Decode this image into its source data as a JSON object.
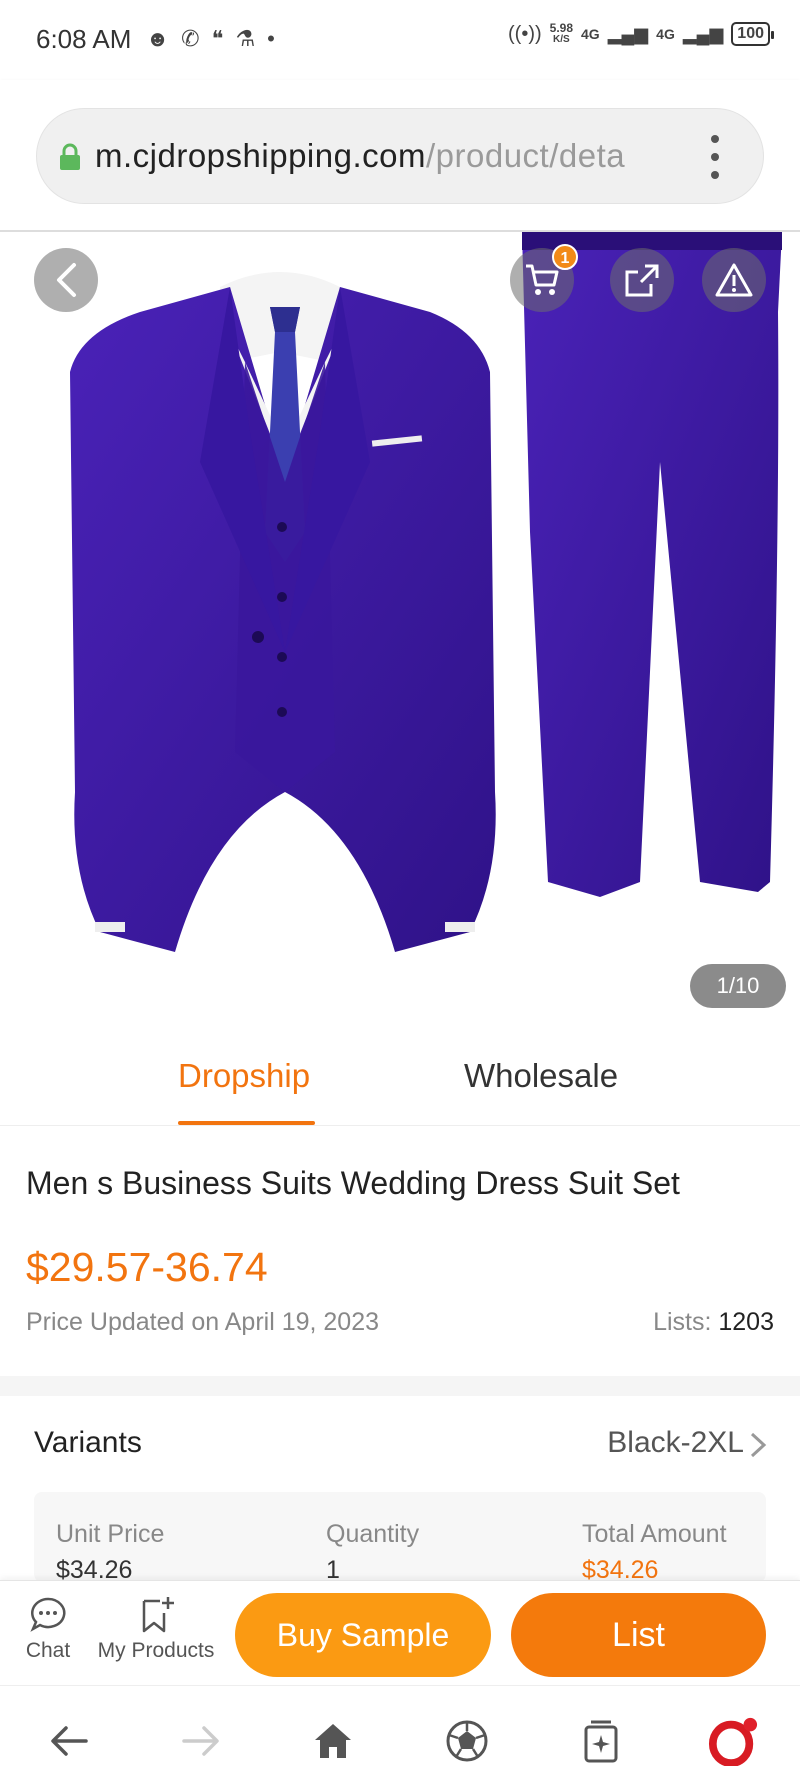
{
  "status_bar": {
    "time": "6:08 AM",
    "net_speed_value": "5.98",
    "net_speed_unit": "K/S",
    "signal1": "4G",
    "signal2": "4G",
    "battery": "100"
  },
  "browser": {
    "url_domain": "m.cjdropshipping.com",
    "url_path": "/product/deta"
  },
  "hero": {
    "cart_count": "1",
    "image_counter": "1/10"
  },
  "tabs": [
    {
      "label": "Dropship",
      "active": true
    },
    {
      "label": "Wholesale",
      "active": false
    }
  ],
  "product": {
    "title": "Men s Business Suits Wedding Dress Suit Set",
    "price": "$29.57-36.74",
    "price_updated": "Price Updated on April 19, 2023",
    "lists_label": "Lists:",
    "lists_count": "1203"
  },
  "variants": {
    "label": "Variants",
    "selected": "Black-2XL",
    "columns": [
      "Unit Price",
      "Quantity",
      "Total Amount"
    ],
    "row": [
      "$34.26",
      "1",
      "$34.26"
    ]
  },
  "action_bar": {
    "chat_label": "Chat",
    "my_products_label": "My Products",
    "buy_sample_label": "Buy Sample",
    "list_label": "List"
  },
  "colors": {
    "accent": "#f2740f",
    "buy_sample": "#fb9a12",
    "list_button": "#f47a0c",
    "suit_purple": "#3e1aa0"
  },
  "icons": [
    "lock-icon",
    "more-vert-icon",
    "back-arrow-icon",
    "cart-icon",
    "share-icon",
    "alert-icon",
    "chevron-right-icon",
    "chat-icon",
    "bookmark-add-icon",
    "nav-back-icon",
    "nav-forward-icon",
    "home-icon",
    "soccer-ball-icon",
    "tabs-icon",
    "opera-icon"
  ]
}
